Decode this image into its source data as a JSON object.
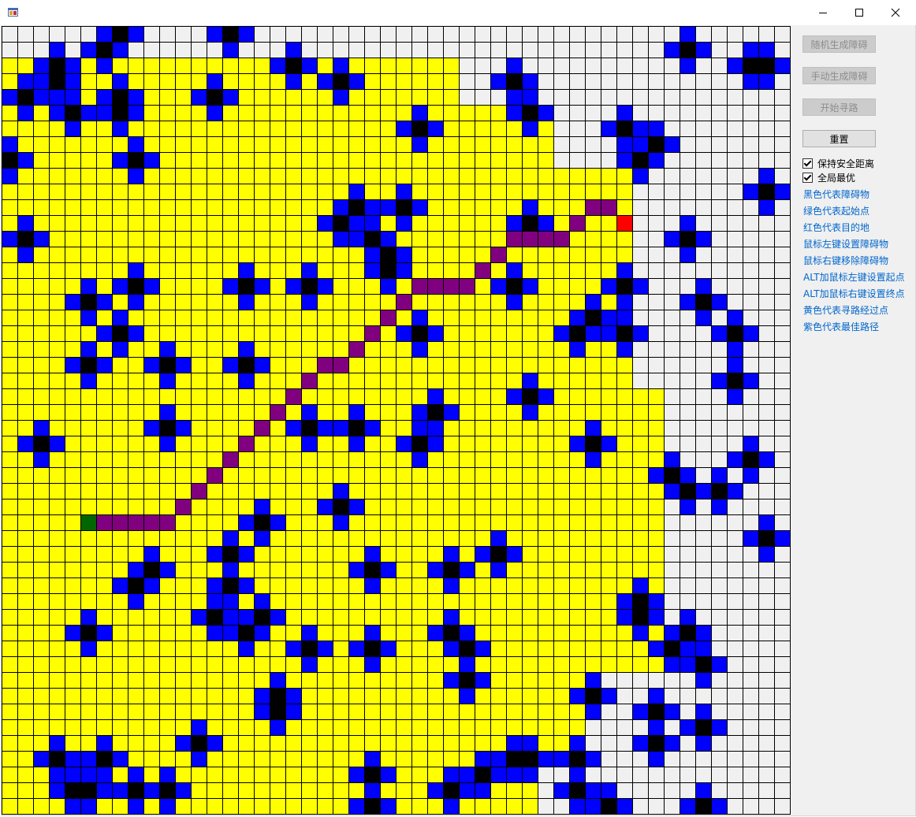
{
  "window": {
    "title": "",
    "controls": {
      "minimize_icon": "minimize-icon",
      "maximize_icon": "maximize-icon",
      "close_icon": "close-icon"
    }
  },
  "grid": {
    "columns": 50,
    "rows": 50,
    "colors": {
      "empty": "#f0f0f0",
      "obstacle": "#000000",
      "buffer": "#0000ff",
      "visited": "#ffff00",
      "path": "#800080",
      "start": "#006600",
      "end": "#ff0000"
    },
    "start_cell": [
      31,
      5
    ],
    "end_cell": [
      12,
      39
    ]
  },
  "controls": {
    "random_obstacles_label": "随机生成障碍",
    "manual_obstacles_label": "手动生成障碍",
    "start_search_label": "开始寻路",
    "reset_label": "重置",
    "keep_safe_distance_label": "保持安全距离",
    "keep_safe_distance_checked": true,
    "global_optimal_label": "全局最优",
    "global_optimal_checked": true
  },
  "legend": [
    "黑色代表障碍物",
    "绿色代表起始点",
    "红色代表目的地",
    "鼠标左键设置障碍物",
    "鼠标右键移除障碍物",
    "ALT加鼠标左键设置起点",
    "ALT加鼠标右键设置终点",
    "黄色代表寻路经过点",
    "紫色代表最佳路径"
  ]
}
